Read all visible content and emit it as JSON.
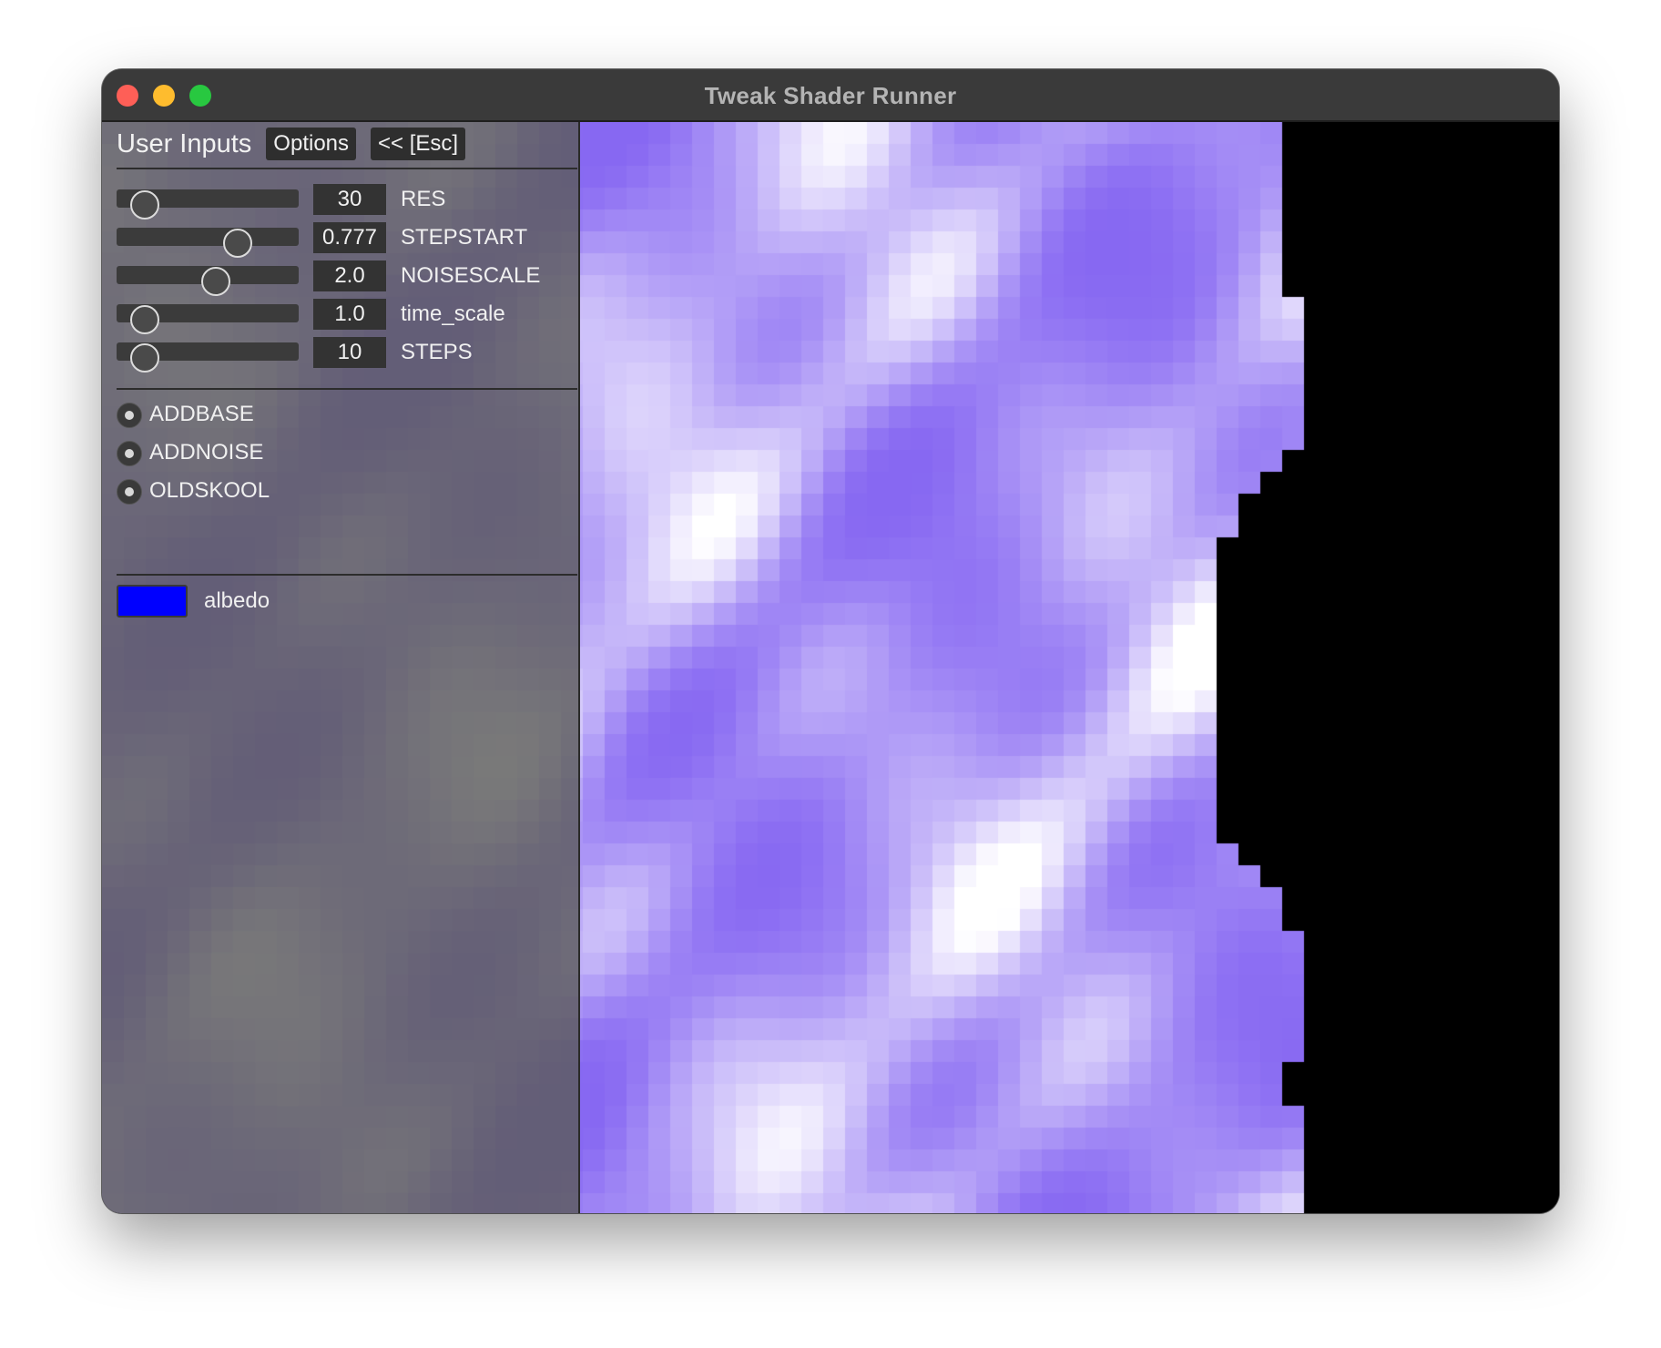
{
  "window": {
    "title": "Tweak Shader Runner"
  },
  "panel": {
    "title": "User Inputs",
    "options_label": "Options",
    "collapse_label": "<< [Esc]",
    "sliders": [
      {
        "name": "RES",
        "value": "30",
        "level": 0.15
      },
      {
        "name": "STEPSTART",
        "value": "0.777",
        "level": 0.66
      },
      {
        "name": "NOISESCALE",
        "value": "2.0",
        "level": 0.54
      },
      {
        "name": "time_scale",
        "value": "1.0",
        "level": 0.15
      },
      {
        "name": "STEPS",
        "value": "10",
        "level": 0.15
      }
    ],
    "toggles": [
      {
        "name": "ADDBASE"
      },
      {
        "name": "ADDNOISE"
      },
      {
        "name": "OLDSKOOL"
      }
    ],
    "color": {
      "name": "albedo",
      "value": "#0000ff"
    }
  },
  "colors": {
    "accent": "#8766f2",
    "background": "#000000"
  }
}
